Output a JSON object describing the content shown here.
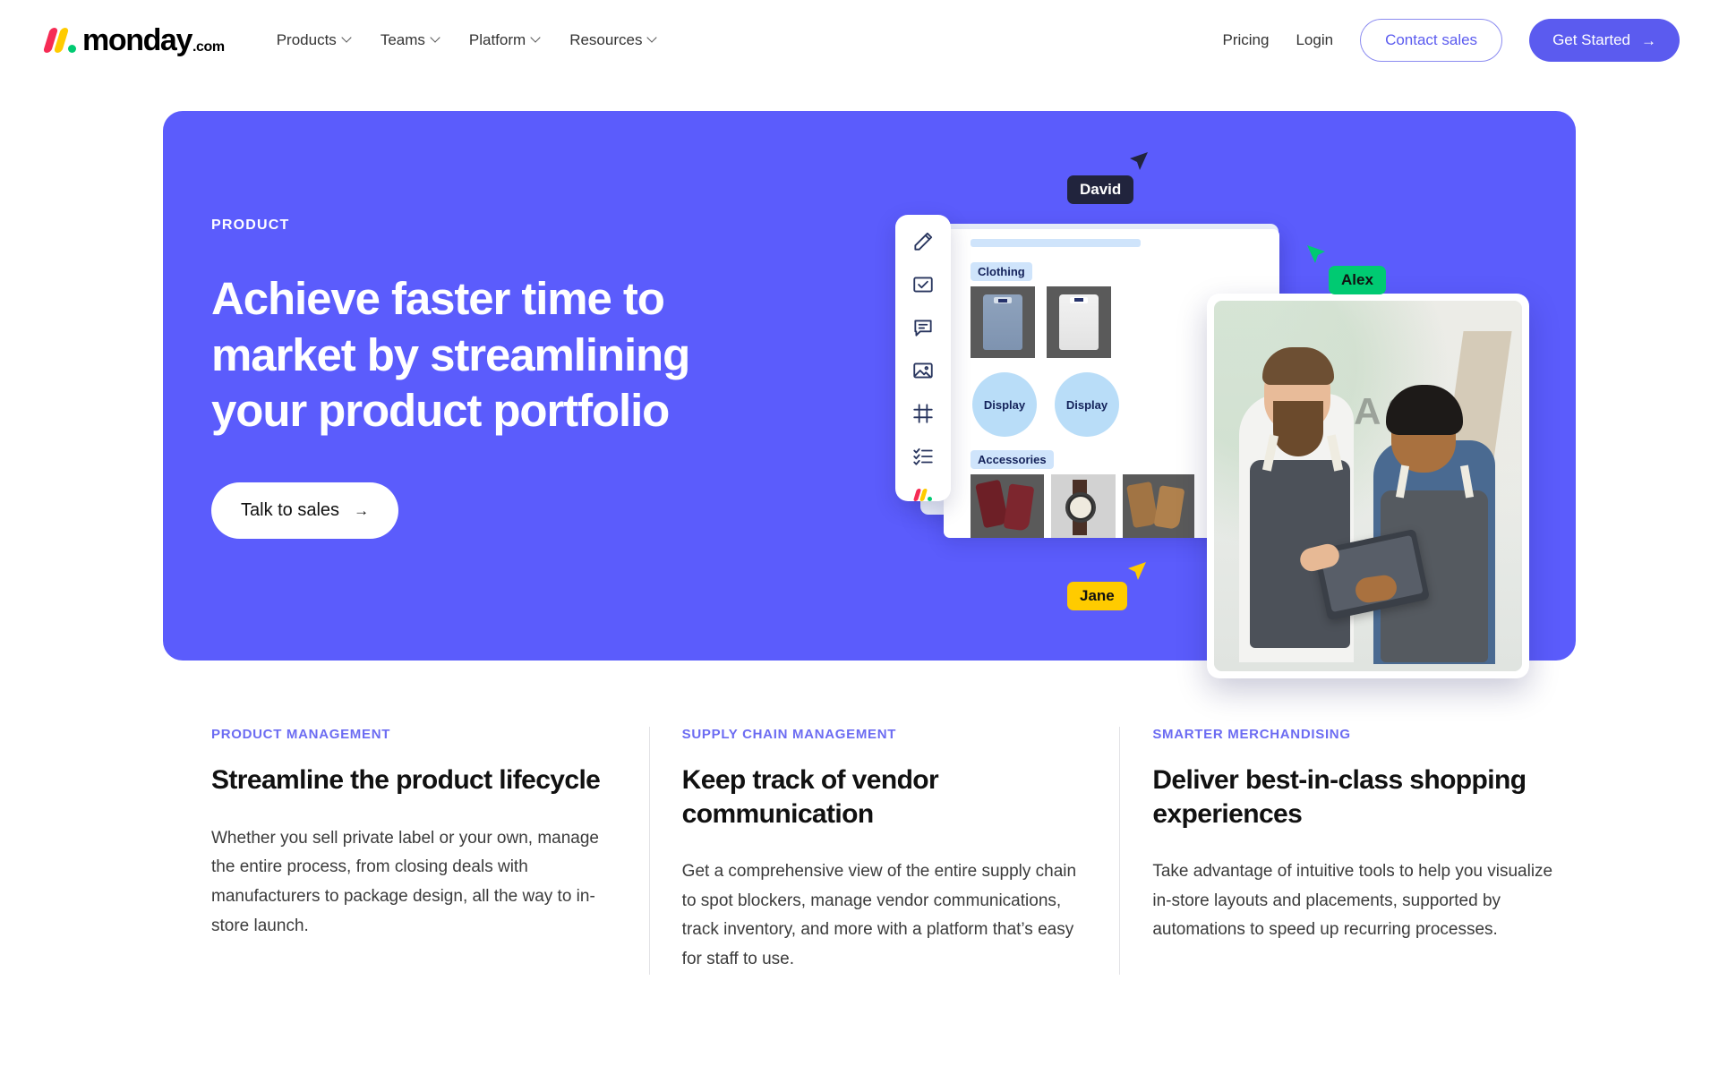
{
  "header": {
    "logo": {
      "word": "monday",
      "tld": ".com"
    },
    "nav": [
      {
        "label": "Products",
        "icon": "chevron-down-icon"
      },
      {
        "label": "Teams",
        "icon": "chevron-down-icon"
      },
      {
        "label": "Platform",
        "icon": "chevron-down-icon"
      },
      {
        "label": "Resources",
        "icon": "chevron-down-icon"
      }
    ],
    "pricing": "Pricing",
    "login": "Login",
    "contact_sales": "Contact sales",
    "get_started": "Get Started",
    "arrow": "→"
  },
  "hero": {
    "eyebrow": "PRODUCT",
    "title": "Achieve faster time to market by streamlining your product portfolio",
    "cta": "Talk to sales",
    "cta_arrow": "→",
    "bg_color": "#5b5cfc"
  },
  "illustration": {
    "board": {
      "section_clothing": "Clothing",
      "section_accessories": "Accessories",
      "display_left": "Display",
      "display_right": "Display"
    },
    "toolbar_icons": [
      "pencil-icon",
      "checkbox-icon",
      "comment-icon",
      "image-icon",
      "crop-frame-icon",
      "checklist-icon",
      "monday-logo-icon"
    ],
    "cursors": [
      {
        "name": "David",
        "bg": "#21243d",
        "fg": "#ffffff",
        "arrow_color": "#21243d"
      },
      {
        "name": "Alex",
        "bg": "#00ca72",
        "fg": "#111111",
        "arrow_color": "#00ca72"
      },
      {
        "name": "Jane",
        "bg": "#ffcb00",
        "fg": "#111111",
        "arrow_color": "#ffcb00"
      }
    ],
    "photo_alt": "two shop staff in aprons looking at a tablet"
  },
  "features": [
    {
      "eyebrow": "PRODUCT MANAGEMENT",
      "title": "Streamline the product lifecycle",
      "body": "Whether you sell private label or your own, manage the entire process, from closing deals with manufacturers to package design, all the way to in-store launch."
    },
    {
      "eyebrow": "SUPPLY CHAIN MANAGEMENT",
      "title": "Keep track of vendor communication",
      "body": "Get a comprehensive view of the entire supply chain to spot blockers, manage vendor communications, track inventory, and more with a platform that’s easy for staff to use."
    },
    {
      "eyebrow": "SMARTER MERCHANDISING",
      "title": "Deliver best-in-class shopping experiences",
      "body": "Take advantage of intuitive tools to help you visualize in-store layouts and placements, supported by automations to speed up recurring processes."
    }
  ]
}
